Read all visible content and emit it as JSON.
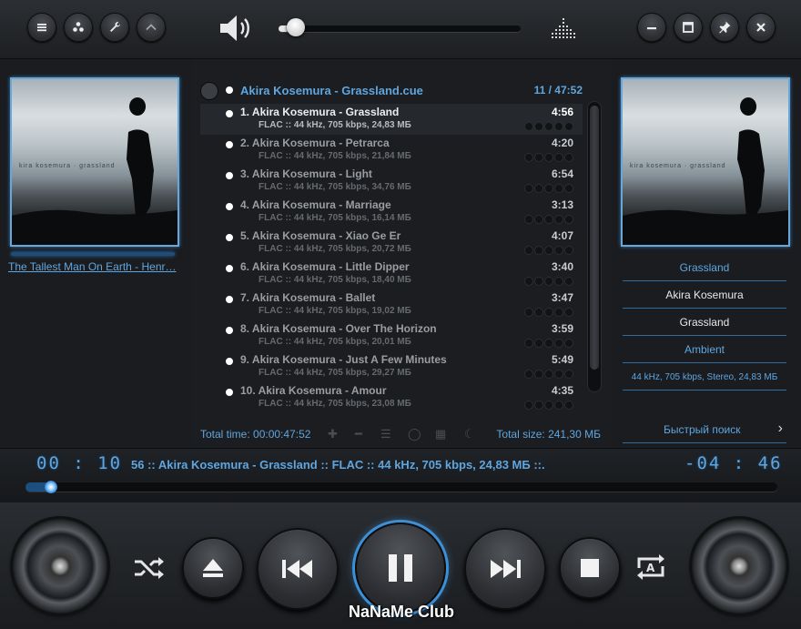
{
  "left_panel": {
    "cover_text": "kira kosemura · grassland",
    "link_label": "The Tallest Man On Earth - Henr…"
  },
  "volume": {
    "level": 0.05
  },
  "playlist": {
    "header_title": "Akira Kosemura - Grassland.cue",
    "header_count": "11 / 47:52",
    "tracks": [
      {
        "title": "1. Akira Kosemura - Grassland",
        "duration": "4:56",
        "meta": "FLAC :: 44 kHz, 705 kbps, 24,83 МБ"
      },
      {
        "title": "2. Akira Kosemura - Petrarca",
        "duration": "4:20",
        "meta": "FLAC :: 44 kHz, 705 kbps, 21,84 МБ"
      },
      {
        "title": "3. Akira Kosemura - Light",
        "duration": "6:54",
        "meta": "FLAC :: 44 kHz, 705 kbps, 34,76 МБ"
      },
      {
        "title": "4. Akira Kosemura - Marriage",
        "duration": "3:13",
        "meta": "FLAC :: 44 kHz, 705 kbps, 16,14 МБ"
      },
      {
        "title": "5. Akira Kosemura - Xiao Ge Er",
        "duration": "4:07",
        "meta": "FLAC :: 44 kHz, 705 kbps, 20,72 МБ"
      },
      {
        "title": "6. Akira Kosemura - Little Dipper",
        "duration": "3:40",
        "meta": "FLAC :: 44 kHz, 705 kbps, 18,40 МБ"
      },
      {
        "title": "7. Akira Kosemura - Ballet",
        "duration": "3:47",
        "meta": "FLAC :: 44 kHz, 705 kbps, 19,02 МБ"
      },
      {
        "title": "8. Akira Kosemura - Over The Horizon",
        "duration": "3:59",
        "meta": "FLAC :: 44 kHz, 705 kbps, 20,01 МБ"
      },
      {
        "title": "9. Akira Kosemura - Just A Few Minutes",
        "duration": "5:49",
        "meta": "FLAC :: 44 kHz, 705 kbps, 29,27 МБ"
      },
      {
        "title": "10. Akira Kosemura - Amour",
        "duration": "4:35",
        "meta": "FLAC :: 44 kHz, 705 kbps, 23,08 МБ"
      }
    ],
    "total_time": "Total time: 00:00:47:52",
    "total_size": "Total size: 241,30 МБ"
  },
  "right_panel": {
    "cover_text": "kira kosemura · grassland",
    "album": "Grassland",
    "artist": "Akira Kosemura",
    "title": "Grassland",
    "genre": "Ambient",
    "format": "44 kHz, 705 kbps, Stereo, 24,83 МБ",
    "search_label": "Быстрый поиск"
  },
  "status": {
    "elapsed": "00 : 10",
    "remaining": "-04 : 46",
    "ticker": "56 :: Akira Kosemura - Grassland :: FLAC :: 44 kHz, 705 kbps, 24,83 МБ ::.",
    "progress": 0.034
  },
  "brand": "NaNaMe Club",
  "colors": {
    "accent": "#5fa6e0",
    "background": "#1b1d20"
  },
  "icons": {
    "top_left": [
      "menu-icon",
      "equalizer-dots-icon",
      "wrench-icon",
      "chevron-up-icon"
    ],
    "top_right": [
      "minimize-icon",
      "maximize-icon",
      "pin-icon",
      "close-icon"
    ],
    "controls": [
      "shuffle-icon",
      "eject-icon",
      "previous-icon",
      "pause-icon",
      "next-icon",
      "stop-icon",
      "repeat-icon"
    ]
  }
}
